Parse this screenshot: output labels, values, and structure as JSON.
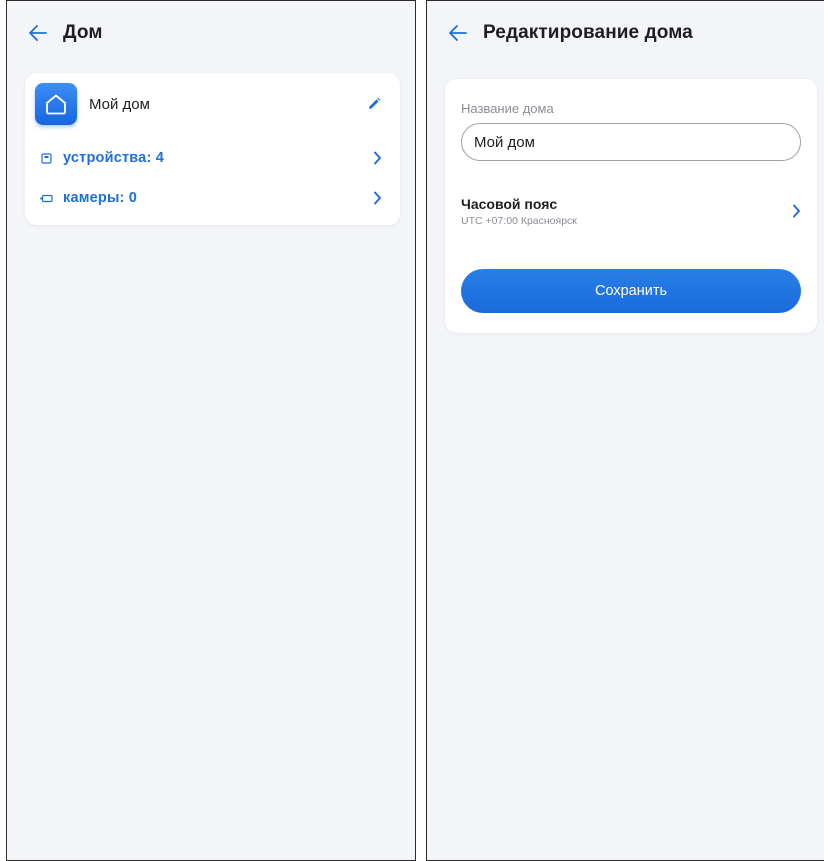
{
  "colors": {
    "accent": "#1e6fd9",
    "background": "#f3f5f9",
    "card": "#ffffff"
  },
  "left_screen": {
    "title": "Дом",
    "home": {
      "name": "Мой дом",
      "icon": "home-icon"
    },
    "rows": [
      {
        "label": "устройства: 4",
        "icon": "device-icon"
      },
      {
        "label": "камеры: 0",
        "icon": "camera-icon"
      }
    ]
  },
  "right_screen": {
    "title": "Редактирование дома",
    "name_field": {
      "label": "Название дома",
      "value": "Мой дом"
    },
    "timezone": {
      "title": "Часовой пояс",
      "value": "UTC +07:00 Красноярск"
    },
    "save_label": "Сохранить"
  }
}
